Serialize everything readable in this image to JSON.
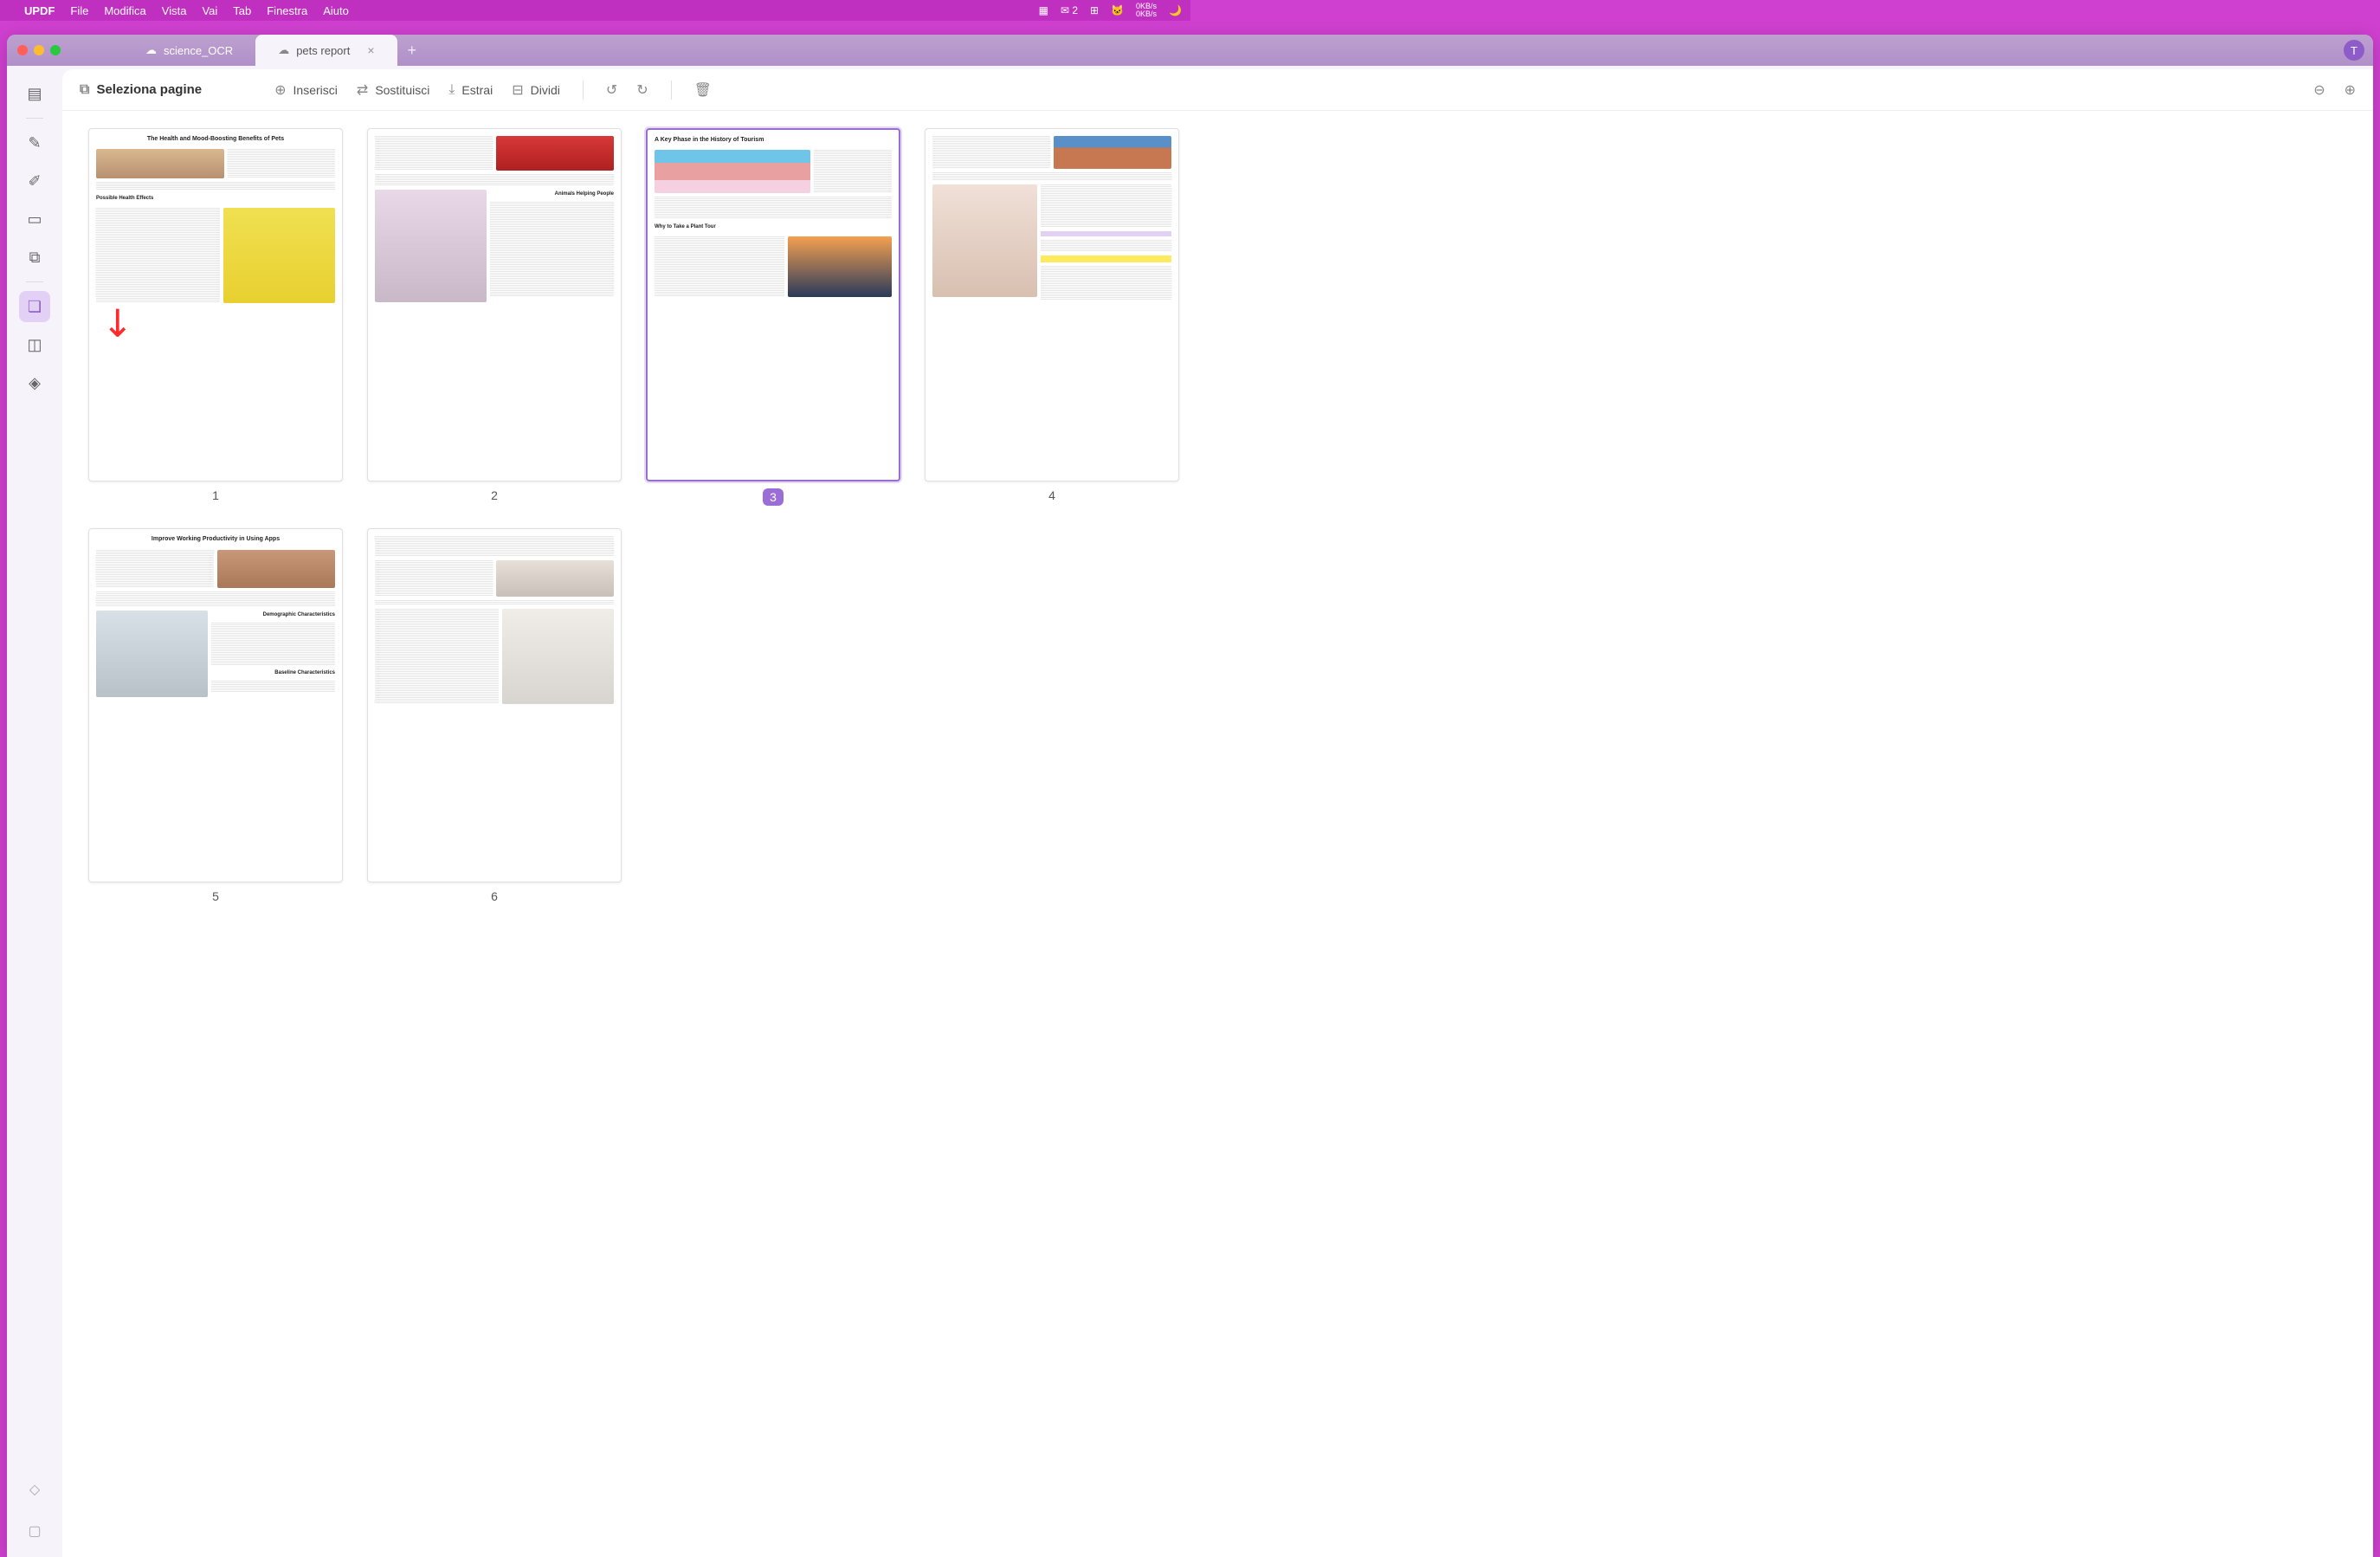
{
  "menubar": {
    "app": "UPDF",
    "items": [
      "File",
      "Modifica",
      "Vista",
      "Vai",
      "Tab",
      "Finestra",
      "Aiuto"
    ],
    "right": {
      "count": "2",
      "kbs_up": "0KB/s",
      "kbs_down": "0KB/s"
    }
  },
  "tabs": [
    {
      "label": "science_OCR"
    },
    {
      "label": "pets report"
    }
  ],
  "avatar": "T",
  "toolbar": {
    "select": "Seleziona pagine",
    "insert": "Inserisci",
    "replace": "Sostituisci",
    "extract": "Estrai",
    "split": "Dividi"
  },
  "pages": [
    {
      "num": "1",
      "title": "The Health and Mood-Boosting Benefits of Pets",
      "sub1": "Possible Health Effects"
    },
    {
      "num": "2",
      "title": "",
      "sub1": "Animals Helping People"
    },
    {
      "num": "3",
      "title": "A Key Phase in the History of Tourism",
      "sub1": "Why to Take a Plant Tour",
      "selected": true
    },
    {
      "num": "4",
      "title": ""
    },
    {
      "num": "5",
      "title": "Improve Working Productivity in Using Apps",
      "sub1": "Demographic Characteristics",
      "sub2": "Baseline Characteristics"
    },
    {
      "num": "6",
      "title": ""
    }
  ]
}
